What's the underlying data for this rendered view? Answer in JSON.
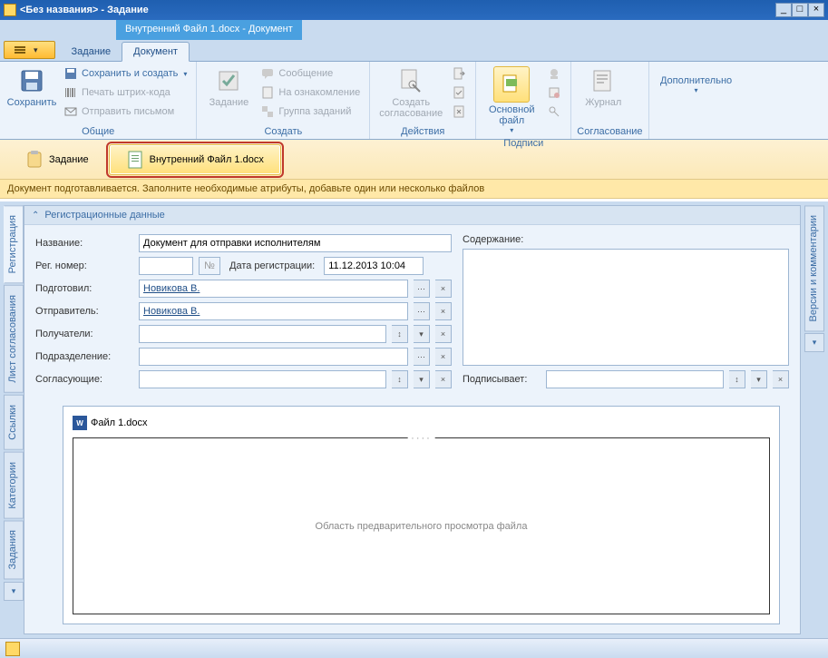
{
  "title": "<Без названия> - Задание",
  "contextTab": "Внутренний Файл 1.docx - Документ",
  "tabs": {
    "task": "Задание",
    "document": "Документ"
  },
  "ribbon": {
    "save": "Сохранить",
    "saveCreate": "Сохранить и создать",
    "printBarcode": "Печать штрих-кода",
    "sendMail": "Отправить письмом",
    "groupCommon": "Общие",
    "taskBtn": "Задание",
    "message": "Сообщение",
    "forReview": "На ознакомление",
    "taskGroup": "Группа заданий",
    "groupCreate": "Создать",
    "createApproval": "Создать согласование",
    "groupActions": "Действия",
    "mainFile": "Основной файл",
    "groupSignatures": "Подписи",
    "journal": "Журнал",
    "groupApproval": "Согласование",
    "additional": "Дополнительно"
  },
  "docTabs": {
    "task": "Задание",
    "file": "Внутренний Файл 1.docx"
  },
  "hint": "Документ подготавливается. Заполните необходимые атрибуты, добавьте один или несколько файлов",
  "sideTabs": {
    "registration": "Регистрация",
    "approvalSheet": "Лист согласования",
    "links": "Ссылки",
    "categories": "Категории",
    "tasks": "Задания",
    "versions": "Версии и комментарии"
  },
  "panelHeader": "Регистрационные данные",
  "form": {
    "nameLabel": "Название:",
    "nameValue": "Документ для отправки исполнителям",
    "regNumLabel": "Рег. номер:",
    "regNumBtn": "№",
    "regDateLabel": "Дата регистрации:",
    "regDateValue": "11.12.2013 10:04",
    "preparedLabel": "Подготовил:",
    "preparedValue": "Новикова В.",
    "senderLabel": "Отправитель:",
    "senderValue": "Новикова В.",
    "recipientsLabel": "Получатели:",
    "departmentLabel": "Подразделение:",
    "approversLabel": "Согласующие:",
    "contentLabel": "Содержание:",
    "signerLabel": "Подписывает:"
  },
  "file": {
    "name": "Файл 1.docx",
    "previewText": "Область предварительного просмотра файла"
  }
}
